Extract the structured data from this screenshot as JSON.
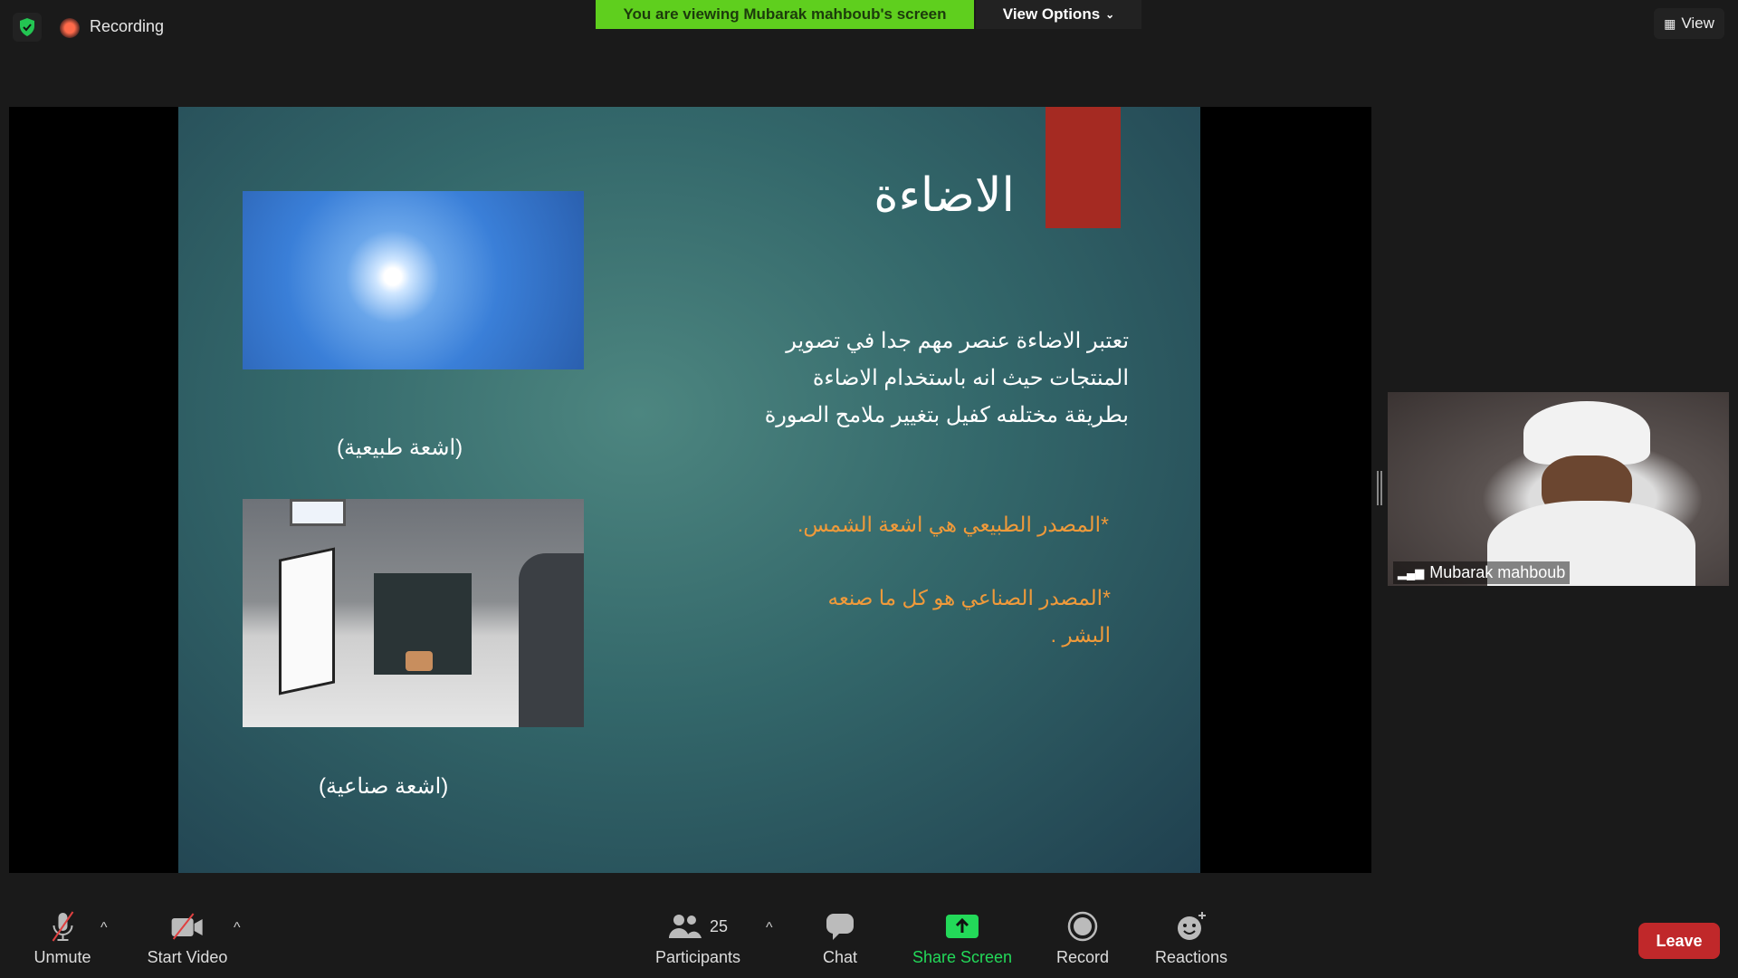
{
  "top": {
    "recording_label": "Recording",
    "banner": "You are viewing Mubarak mahboub's screen",
    "view_options": "View Options",
    "view": "View"
  },
  "slide": {
    "title": "الاضاءة",
    "body": [
      "تعتبر الاضاءة عنصر مهم جدا في تصوير",
      "المنتجات حيث انه باستخدام الاضاءة",
      "بطريقة مختلفه كفيل بتغيير ملامح الصورة"
    ],
    "point1": "*المصدر الطبيعي هي اشعة الشمس.",
    "point2": [
      "*المصدر الصناعي هو كل ما صنعه",
      "البشر ."
    ],
    "caption1": "(اشعة طبيعية)",
    "caption2": "(اشعة صناعية)"
  },
  "participant": {
    "name": "Mubarak mahboub"
  },
  "toolbar": {
    "unmute": "Unmute",
    "start_video": "Start Video",
    "participants": "Participants",
    "participants_count": "25",
    "chat": "Chat",
    "share_screen": "Share Screen",
    "record": "Record",
    "reactions": "Reactions",
    "leave": "Leave"
  },
  "colors": {
    "banner": "#5fcf1e",
    "share": "#23d959",
    "leave": "#c0282a",
    "accent_orange": "#f09a3a",
    "slide_red": "#a52a22"
  }
}
